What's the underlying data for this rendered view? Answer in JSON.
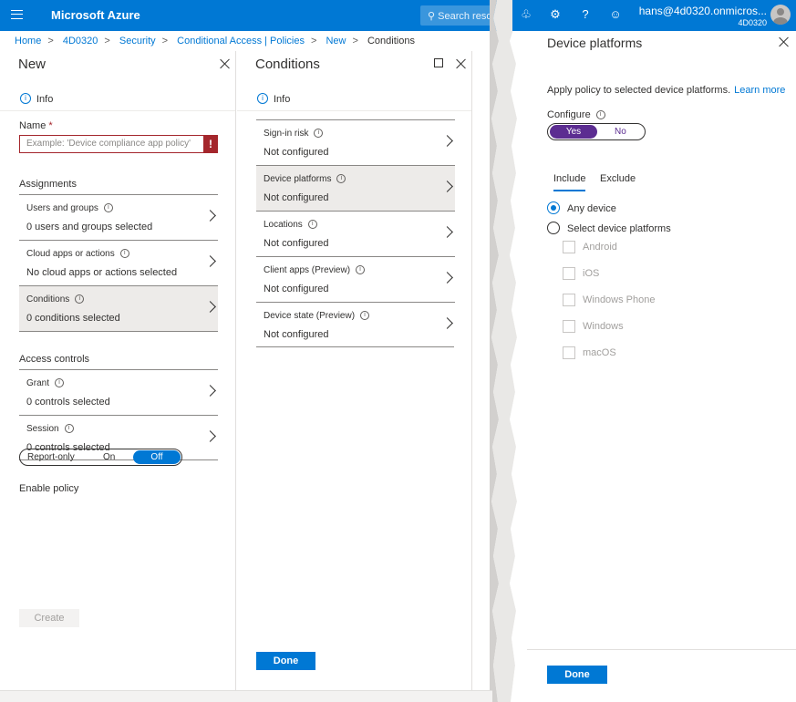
{
  "topbar": {
    "brand": "Microsoft Azure",
    "search_placeholder": "Search reso",
    "user": "hans@4d0320.onmicros...",
    "tenant": "4D0320"
  },
  "breadcrumb": [
    "Home",
    "4D0320",
    "Security",
    "Conditional Access | Policies",
    "New",
    "Conditions"
  ],
  "new_blade": {
    "title": "New",
    "info": "Info",
    "name_label": "Name",
    "required_mark": "*",
    "name_placeholder": "Example: 'Device compliance app policy'",
    "assignments_label": "Assignments",
    "assignments": [
      {
        "title": "Users and groups",
        "value": "0 users and groups selected"
      },
      {
        "title": "Cloud apps or actions",
        "value": "No cloud apps or actions selected"
      },
      {
        "title": "Conditions",
        "value": "0 conditions selected"
      }
    ],
    "access_controls_label": "Access controls",
    "access_controls": [
      {
        "title": "Grant",
        "value": "0 controls selected"
      },
      {
        "title": "Session",
        "value": "0 controls selected"
      }
    ],
    "enable_policy_label": "Enable policy",
    "enable_options": [
      "Report-only",
      "On",
      "Off"
    ],
    "enable_selected": "Off",
    "create_label": "Create"
  },
  "conditions_blade": {
    "title": "Conditions",
    "info": "Info",
    "items": [
      {
        "title": "Sign-in risk",
        "value": "Not configured"
      },
      {
        "title": "Device platforms",
        "value": "Not configured"
      },
      {
        "title": "Locations",
        "value": "Not configured"
      },
      {
        "title": "Client apps (Preview)",
        "value": "Not configured"
      },
      {
        "title": "Device state (Preview)",
        "value": "Not configured"
      }
    ],
    "done_label": "Done"
  },
  "device_platforms": {
    "title": "Device platforms",
    "description": "Apply policy to selected device platforms.",
    "learn_more": "Learn more",
    "configure_label": "Configure",
    "yes": "Yes",
    "no": "No",
    "tabs": [
      "Include",
      "Exclude"
    ],
    "radio_any": "Any device",
    "radio_select": "Select device platforms",
    "platforms": [
      "Android",
      "iOS",
      "Windows Phone",
      "Windows",
      "macOS"
    ],
    "done_label": "Done"
  },
  "colors": {
    "accent": "#0078d4",
    "purple": "#5c2d91",
    "error": "#a4262c"
  }
}
